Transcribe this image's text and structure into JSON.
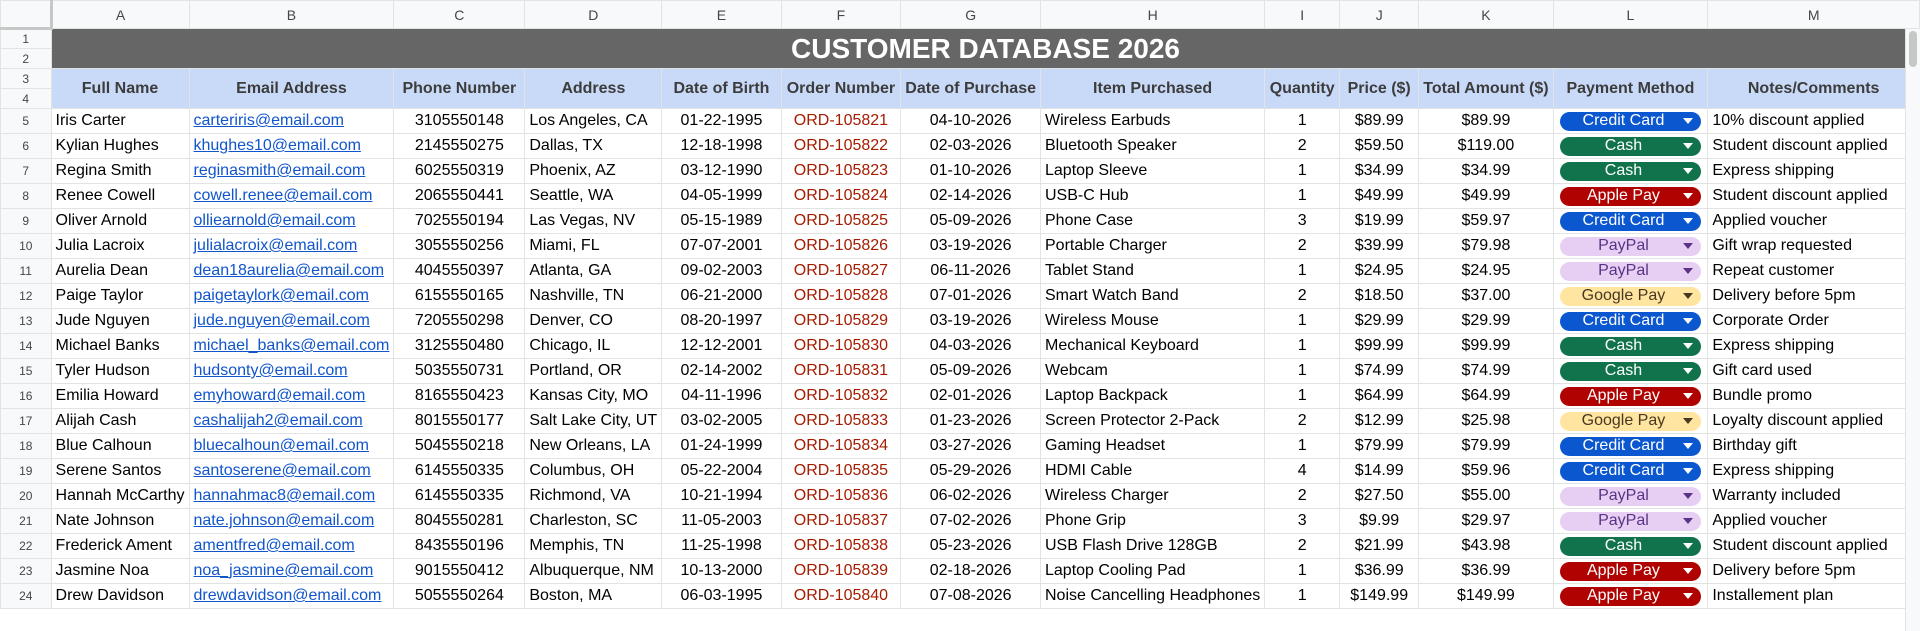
{
  "columns": [
    "A",
    "B",
    "C",
    "D",
    "E",
    "F",
    "G",
    "H",
    "I",
    "J",
    "K",
    "L",
    "M"
  ],
  "title": "CUSTOMER DATABASE 2026",
  "headers": [
    "Full Name",
    "Email Address",
    "Phone Number",
    "Address",
    "Date of Birth",
    "Order Number",
    "Date of Purchase",
    "Item Purchased",
    "Quantity",
    "Price ($)",
    "Total Amount ($)",
    "Payment Method",
    "Notes/Comments"
  ],
  "payment_styles": {
    "Credit Card": {
      "bg": "#0b57d0",
      "fg": "#ffffff"
    },
    "Cash": {
      "bg": "#11734b",
      "fg": "#ffffff"
    },
    "Apple Pay": {
      "bg": "#b10202",
      "fg": "#ffffff"
    },
    "PayPal": {
      "bg": "#e6cff2",
      "fg": "#5a3286"
    },
    "Google Pay": {
      "bg": "#ffe5a0",
      "fg": "#473821"
    }
  },
  "rows": [
    [
      "Iris Carter",
      "carteriris@email.com",
      "3105550148",
      "Los Angeles, CA",
      "01-22-1995",
      "ORD-105821",
      "04-10-2026",
      "Wireless Earbuds",
      "1",
      "$89.99",
      "$89.99",
      "Credit Card",
      "10% discount applied"
    ],
    [
      "Kylian Hughes",
      "khughes10@email.com",
      "2145550275",
      "Dallas, TX",
      "12-18-1998",
      "ORD-105822",
      "02-03-2026",
      "Bluetooth Speaker",
      "2",
      "$59.50",
      "$119.00",
      "Cash",
      "Student discount applied"
    ],
    [
      "Regina Smith",
      "reginasmith@email.com",
      "6025550319",
      "Phoenix, AZ",
      "03-12-1990",
      "ORD-105823",
      "01-10-2026",
      "Laptop Sleeve",
      "1",
      "$34.99",
      "$34.99",
      "Cash",
      "Express shipping"
    ],
    [
      "Renee Cowell",
      "cowell.renee@email.com",
      "2065550441",
      "Seattle, WA",
      "04-05-1999",
      "ORD-105824",
      "02-14-2026",
      "USB-C Hub",
      "1",
      "$49.99",
      "$49.99",
      "Apple Pay",
      "Student discount applied"
    ],
    [
      "Oliver Arnold",
      "olliearnold@email.com",
      "7025550194",
      "Las Vegas, NV",
      "05-15-1989",
      "ORD-105825",
      "05-09-2026",
      "Phone Case",
      "3",
      "$19.99",
      "$59.97",
      "Credit Card",
      "Applied voucher"
    ],
    [
      "Julia Lacroix",
      "julialacroix@email.com",
      "3055550256",
      "Miami, FL",
      "07-07-2001",
      "ORD-105826",
      "03-19-2026",
      "Portable Charger",
      "2",
      "$39.99",
      "$79.98",
      "PayPal",
      "Gift wrap requested"
    ],
    [
      "Aurelia Dean",
      "dean18aurelia@email.com",
      "4045550397",
      "Atlanta, GA",
      "09-02-2003",
      "ORD-105827",
      "06-11-2026",
      "Tablet Stand",
      "1",
      "$24.95",
      "$24.95",
      "PayPal",
      "Repeat customer"
    ],
    [
      "Paige Taylor",
      "paigetaylork@email.com",
      "6155550165",
      "Nashville, TN",
      "06-21-2000",
      "ORD-105828",
      "07-01-2026",
      "Smart Watch Band",
      "2",
      "$18.50",
      "$37.00",
      "Google Pay",
      "Delivery before 5pm"
    ],
    [
      "Jude Nguyen",
      "jude.nguyen@email.com",
      "7205550298",
      "Denver, CO",
      "08-20-1997",
      "ORD-105829",
      "03-19-2026",
      "Wireless Mouse",
      "1",
      "$29.99",
      "$29.99",
      "Credit Card",
      "Corporate Order"
    ],
    [
      "Michael Banks",
      "michael_banks@email.com",
      "3125550480",
      "Chicago, IL",
      "12-12-2001",
      "ORD-105830",
      "04-03-2026",
      "Mechanical Keyboard",
      "1",
      "$99.99",
      "$99.99",
      "Cash",
      "Express shipping"
    ],
    [
      "Tyler Hudson",
      "hudsonty@email.com",
      "5035550731",
      "Portland, OR",
      "02-14-2002",
      "ORD-105831",
      "05-09-2026",
      "Webcam",
      "1",
      "$74.99",
      "$74.99",
      "Cash",
      "Gift card used"
    ],
    [
      "Emilia Howard",
      "emyhoward@email.com",
      "8165550423",
      "Kansas City, MO",
      "04-11-1996",
      "ORD-105832",
      "02-01-2026",
      "Laptop Backpack",
      "1",
      "$64.99",
      "$64.99",
      "Apple Pay",
      "Bundle promo"
    ],
    [
      "Alijah Cash",
      "cashalijah2@email.com",
      "8015550177",
      "Salt Lake City, UT",
      "03-02-2005",
      "ORD-105833",
      "01-23-2026",
      "Screen Protector 2-Pack",
      "2",
      "$12.99",
      "$25.98",
      "Google Pay",
      "Loyalty discount applied"
    ],
    [
      "Blue Calhoun",
      "bluecalhoun@email.com",
      "5045550218",
      "New Orleans, LA",
      "01-24-1999",
      "ORD-105834",
      "03-27-2026",
      "Gaming Headset",
      "1",
      "$79.99",
      "$79.99",
      "Credit Card",
      "Birthday gift"
    ],
    [
      "Serene Santos",
      "santoserene@email.com",
      "6145550335",
      "Columbus, OH",
      "05-22-2004",
      "ORD-105835",
      "05-29-2026",
      "HDMI Cable",
      "4",
      "$14.99",
      "$59.96",
      "Credit Card",
      "Express shipping"
    ],
    [
      "Hannah McCarthy",
      "hannahmac8@email.com",
      "6145550335",
      "Richmond, VA",
      "10-21-1994",
      "ORD-105836",
      "06-02-2026",
      "Wireless Charger",
      "2",
      "$27.50",
      "$55.00",
      "PayPal",
      "Warranty included"
    ],
    [
      "Nate Johnson",
      "nate.johnson@email.com",
      "8045550281",
      "Charleston, SC",
      "11-05-2003",
      "ORD-105837",
      "07-02-2026",
      "Phone Grip",
      "3",
      "$9.99",
      "$29.97",
      "PayPal",
      "Applied voucher"
    ],
    [
      "Frederick Ament",
      "amentfred@email.com",
      "8435550196",
      "Memphis, TN",
      "11-25-1998",
      "ORD-105838",
      "05-23-2026",
      "USB Flash Drive 128GB",
      "2",
      "$21.99",
      "$43.98",
      "Cash",
      "Student discount applied"
    ],
    [
      "Jasmine Noa",
      "noa_jasmine@email.com",
      "9015550412",
      "Albuquerque, NM",
      "10-13-2000",
      "ORD-105839",
      "02-18-2026",
      "Laptop Cooling Pad",
      "1",
      "$36.99",
      "$36.99",
      "Apple Pay",
      "Delivery before 5pm"
    ],
    [
      "Drew Davidson",
      "drewdavidson@email.com",
      "5055550264",
      "Boston, MA",
      "06-03-1995",
      "ORD-105840",
      "07-08-2026",
      "Noise Cancelling Headphones",
      "1",
      "$149.99",
      "$149.99",
      "Apple Pay",
      "Installement plan"
    ]
  ]
}
